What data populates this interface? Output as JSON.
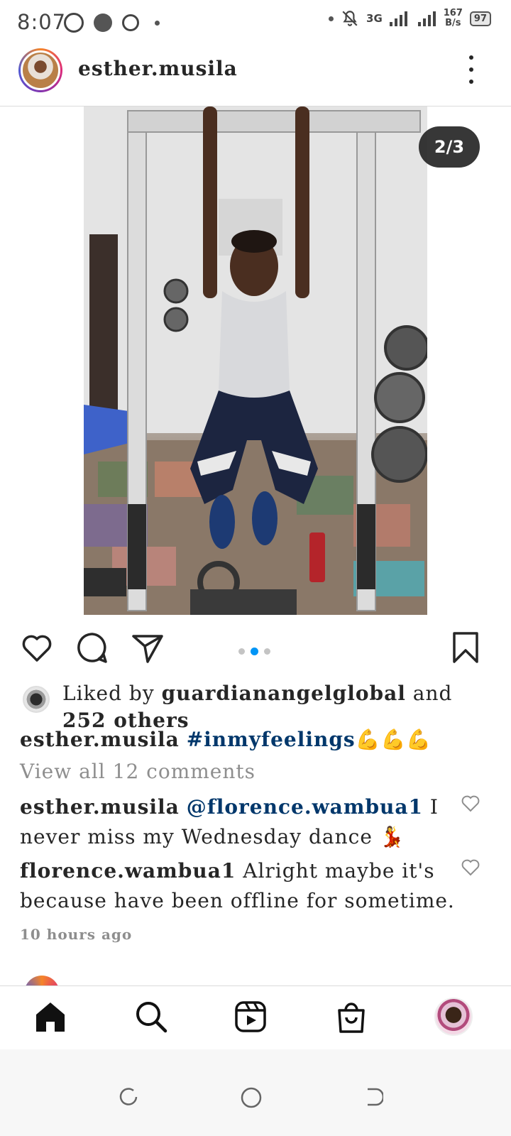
{
  "status_bar": {
    "time": "8:07",
    "network": "3G",
    "speed_value": "167",
    "speed_unit": "B/s",
    "battery": "97"
  },
  "post": {
    "username": "esther.musila",
    "slide_counter": "2/3",
    "media_description": "gym photo"
  },
  "likes": {
    "prefix": "Liked by ",
    "liker": "guardianangelglobal",
    "middle": " and ",
    "count": "252",
    "suffix": " others"
  },
  "caption": {
    "username": "esther.musila",
    "hashtag": "#inmyfeelings",
    "emoji": "💪💪💪"
  },
  "view_all_comments": "View all 12 comments",
  "comments": [
    {
      "username": "esther.musila",
      "mention": "@florence.wambua1",
      "text": " I never miss my Wednesday dance 💃"
    },
    {
      "username": "florence.wambua1",
      "text": " Alright maybe it's because have been offline for sometime."
    }
  ],
  "time_ago": "10 hours ago",
  "icons": {
    "like": "heart-icon",
    "comment": "comment-icon",
    "share": "send-icon",
    "save": "bookmark-icon",
    "home": "home-icon",
    "search": "search-icon",
    "reels": "reels-icon",
    "shop": "shop-icon",
    "more": "more-vertical-icon"
  },
  "colors": {
    "accent_blue": "#0095f6",
    "hashtag": "#00376b",
    "muted": "#8e8e8e"
  }
}
